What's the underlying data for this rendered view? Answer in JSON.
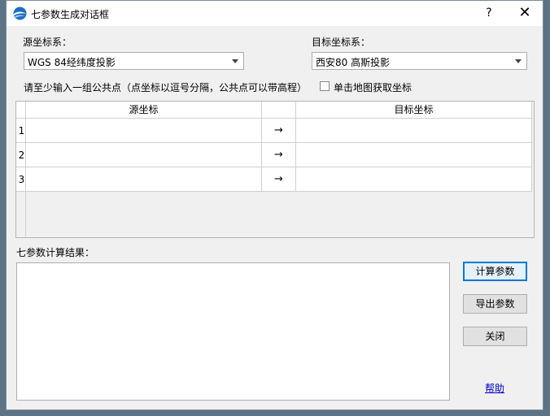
{
  "window": {
    "title": "七参数生成对话框",
    "help_glyph": "?",
    "close_glyph": "✕"
  },
  "source": {
    "label": "源坐标系：",
    "selected": "WGS 84经纬度投影"
  },
  "target": {
    "label": "目标坐标系：",
    "selected": "西安80 高斯投影"
  },
  "instruction": "请至少输入一组公共点（点坐标以逗号分隔，公共点可以带高程）",
  "map_pick": {
    "label": "单击地图获取坐标",
    "checked": false
  },
  "table": {
    "columns": [
      "源坐标",
      "",
      "目标坐标"
    ],
    "rows": [
      {
        "num": "1",
        "source": "",
        "arrow": "→",
        "target": ""
      },
      {
        "num": "2",
        "source": "",
        "arrow": "→",
        "target": ""
      },
      {
        "num": "3",
        "source": "",
        "arrow": "→",
        "target": ""
      }
    ]
  },
  "result": {
    "label": "七参数计算结果：",
    "value": ""
  },
  "buttons": {
    "compute": "计算参数",
    "export": "导出参数",
    "close": "关闭",
    "help": "帮助"
  }
}
